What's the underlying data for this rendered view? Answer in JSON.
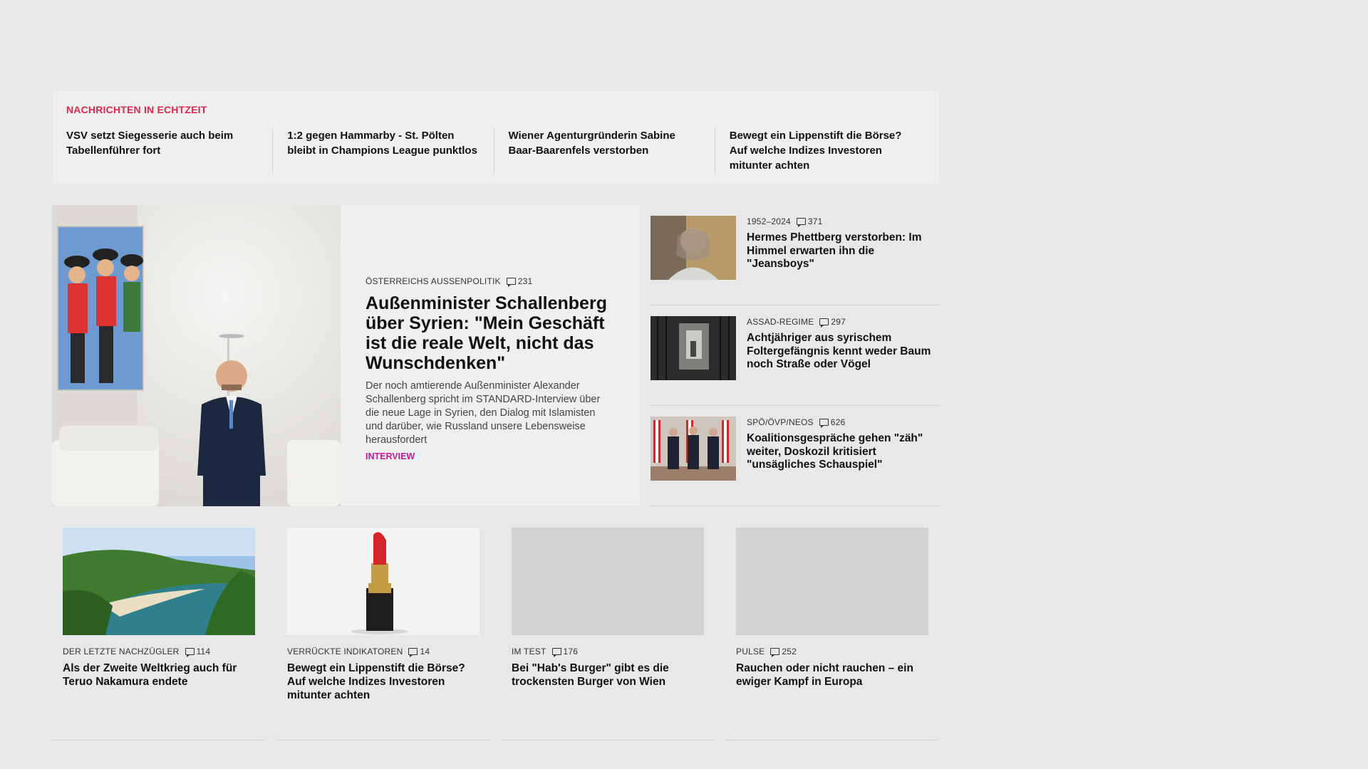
{
  "ticker": {
    "label": "NACHRICHTEN IN ECHTZEIT",
    "items": [
      "VSV setzt Siegesserie auch beim Tabellenführer fort",
      "1:2 gegen Hammarby - St. Pölten bleibt in Champions League punktlos",
      "Wiener Agenturgründerin Sabine Baar-Baarenfels verstorben",
      "Bewegt ein Lippenstift die Börse? Auf welche Indizes Investoren mitunter achten"
    ]
  },
  "lead": {
    "kicker": "ÖSTERREICHS AUSSENPOLITIK",
    "comments": "231",
    "title": "Außenminister Schallenberg über Syrien: \"Mein Geschäft ist die reale Welt, nicht das Wunschdenken\"",
    "teaser": "Der noch amtierende Außenminister Alexander Schallenberg spricht im STANDARD-Interview über die neue Lage in Syrien, den Dialog mit Islamisten und darüber, wie Russland unsere Lebensweise herausfordert",
    "tag": "INTERVIEW"
  },
  "side": [
    {
      "kicker": "1952–2024",
      "comments": "371",
      "title": "Hermes Phettberg verstorben: Im Himmel erwarten ihn die \"Jeansboys\""
    },
    {
      "kicker": "ASSAD-REGIME",
      "comments": "297",
      "title": "Achtjähriger aus syrischem Foltergefängnis kennt weder Baum noch Straße oder Vögel"
    },
    {
      "kicker": "SPÖ/ÖVP/NEOS",
      "comments": "626",
      "title": "Koalitionsgespräche gehen \"zäh\" weiter, Doskozil kritisiert \"unsägliches Schauspiel\""
    }
  ],
  "cards": [
    {
      "kicker": "DER LETZTE NACHZÜGLER",
      "comments": "114",
      "title": "Als der Zweite Weltkrieg auch für Teruo Nakamura endete"
    },
    {
      "kicker": "VERRÜCKTE INDIKATOREN",
      "comments": "14",
      "title": "Bewegt ein Lippenstift die Börse? Auf welche Indizes Investoren mitunter achten"
    },
    {
      "kicker": "IM TEST",
      "comments": "176",
      "title": "Bei \"Hab's Burger\" gibt es die trockensten Burger von Wien"
    },
    {
      "kicker": "PULSE",
      "comments": "252",
      "title": "Rauchen oder nicht rauchen – ein ewiger Kampf in Europa"
    }
  ],
  "colors": {
    "accent_red": "#e0284a",
    "interview_magenta": "#c8179c",
    "background": "#e8e8e8"
  }
}
